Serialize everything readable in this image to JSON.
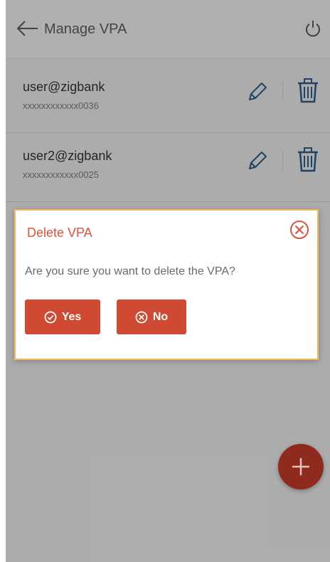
{
  "header": {
    "title": "Manage VPA"
  },
  "vpa_list": [
    {
      "vpa": "user@zigbank",
      "account": "xxxxxxxxxxxx0036"
    },
    {
      "vpa": "user2@zigbank",
      "account": "xxxxxxxxxxxx0025"
    }
  ],
  "dialog": {
    "title": "Delete VPA",
    "message": "Are you sure you want to delete the VPA?",
    "yes_label": "Yes",
    "no_label": "No"
  },
  "icons": {
    "back": "arrow-left-icon",
    "power": "power-icon",
    "edit": "pencil-icon",
    "delete": "trash-icon",
    "close": "close-circle-icon",
    "yes": "check-circle-icon",
    "no": "x-circle-icon",
    "fab": "plus-icon"
  },
  "colors": {
    "accent": "#d04a33",
    "fab": "#8f2b1c",
    "icon_blue": "#2a5b84",
    "dialog_border": "#f4b860"
  }
}
